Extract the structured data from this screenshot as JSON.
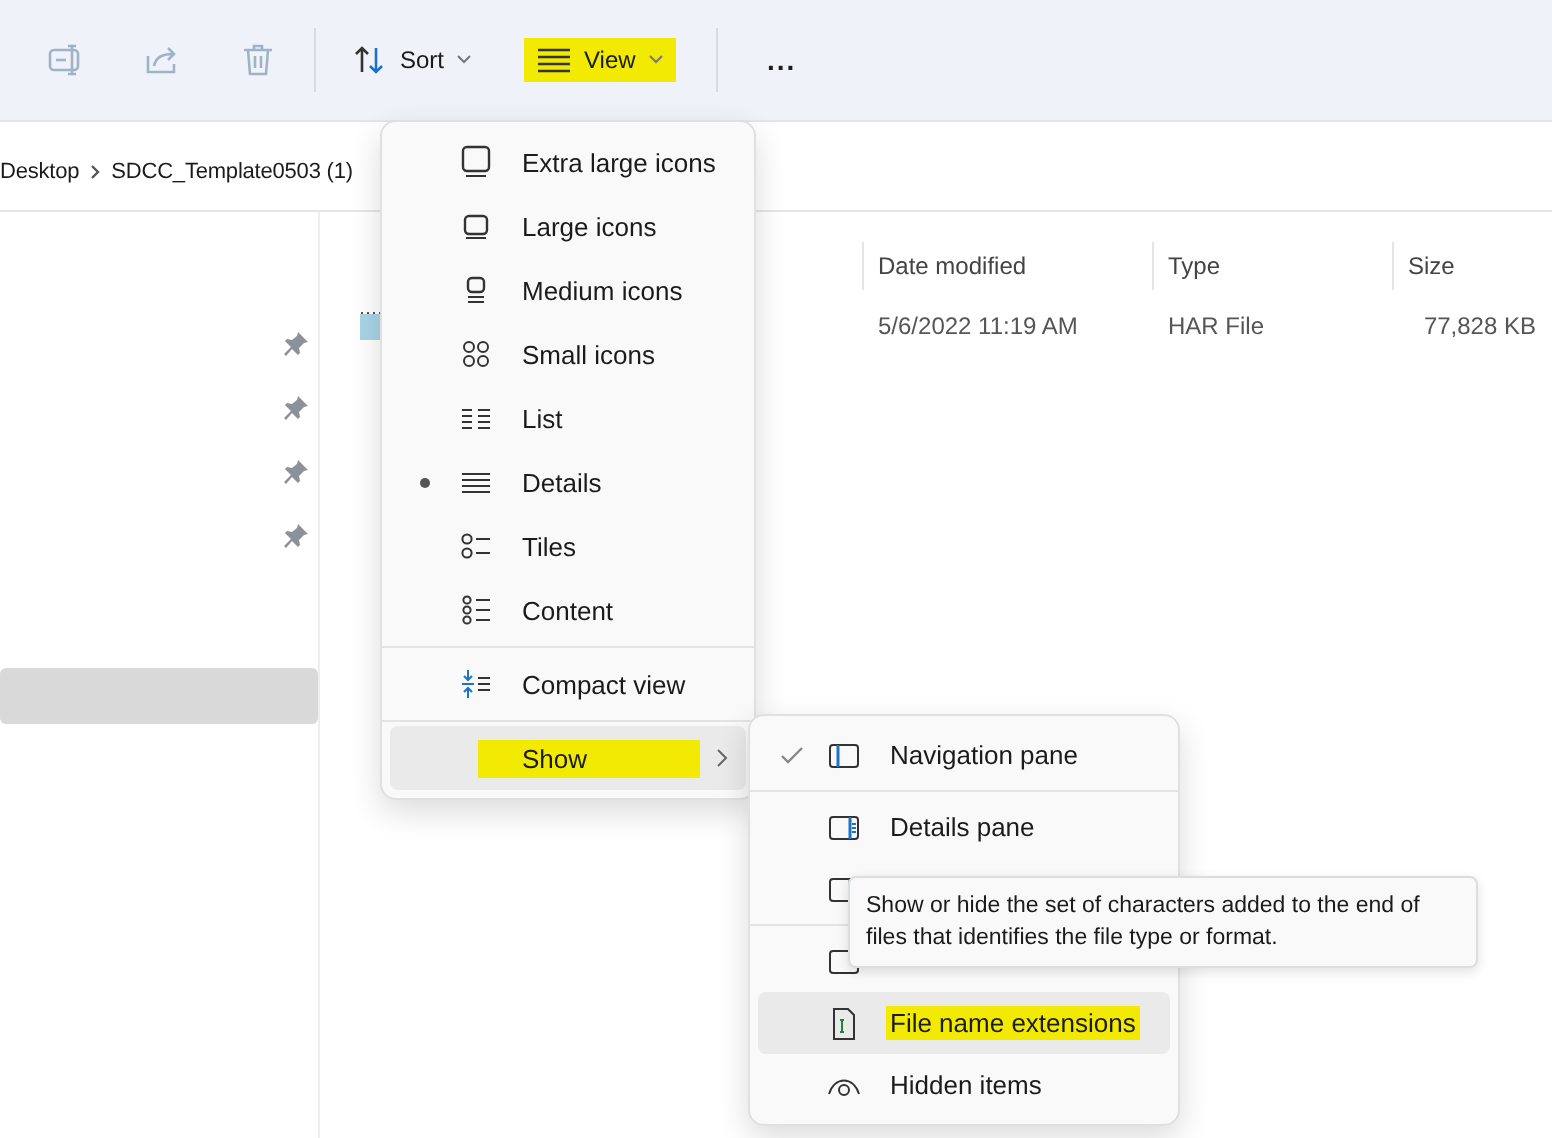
{
  "toolbar": {
    "buttons": [
      {
        "kind": "rename",
        "disabled": true
      },
      {
        "kind": "share",
        "disabled": true
      },
      {
        "kind": "delete",
        "disabled": true
      }
    ],
    "sort": {
      "label": "Sort",
      "highlighted": false
    },
    "view": {
      "label": "View",
      "highlighted": true
    },
    "more": "..."
  },
  "breadcrumb": [
    "Desktop",
    "SDCC_Template0503 (1)"
  ],
  "sidebar": {
    "items": [
      {
        "pinned": true,
        "selected": false
      },
      {
        "pinned": true,
        "selected": false
      },
      {
        "pinned": true,
        "selected": false
      },
      {
        "pinned": true,
        "selected": false
      },
      {
        "pinned": false,
        "selected": true
      }
    ]
  },
  "table": {
    "columns": [
      "Date modified",
      "Type",
      "Size"
    ],
    "rows": [
      {
        "date_modified": "5/6/2022 11:19 AM",
        "type": "HAR File",
        "size": "77,828 KB"
      }
    ]
  },
  "view_menu": {
    "items": [
      {
        "kind": "xl",
        "label": "Extra large icons",
        "selected": false
      },
      {
        "kind": "large",
        "label": "Large icons",
        "selected": false
      },
      {
        "kind": "medium",
        "label": "Medium icons",
        "selected": false
      },
      {
        "kind": "small",
        "label": "Small icons",
        "selected": false
      },
      {
        "kind": "list",
        "label": "List",
        "selected": false
      },
      {
        "kind": "details",
        "label": "Details",
        "selected": true
      },
      {
        "kind": "tiles",
        "label": "Tiles",
        "selected": false
      },
      {
        "kind": "content",
        "label": "Content",
        "selected": false
      },
      {
        "kind": "compact",
        "label": "Compact view",
        "selected": false
      },
      {
        "kind": "show",
        "label": "Show",
        "selected": false,
        "hovered": true,
        "highlighted": true
      }
    ]
  },
  "show_menu": {
    "items": [
      {
        "kind": "navpane",
        "label": "Navigation pane",
        "checked": true,
        "hovered": false,
        "highlighted": false
      },
      {
        "kind": "detailspane",
        "label": "Details pane",
        "checked": false,
        "hovered": false,
        "highlighted": false
      },
      {
        "kind": "previewpane",
        "checked": false,
        "hovered": false
      },
      {
        "kind": "checkboxes",
        "checked": false,
        "hovered": false
      },
      {
        "kind": "extensions",
        "label": "File name extensions",
        "checked": false,
        "hovered": true,
        "highlighted": true
      },
      {
        "kind": "hidden",
        "label": "Hidden items",
        "checked": false,
        "hovered": false,
        "highlighted": false
      }
    ]
  },
  "tooltip": "Show or hide the set of characters added to the end of files that identifies the file type or format."
}
